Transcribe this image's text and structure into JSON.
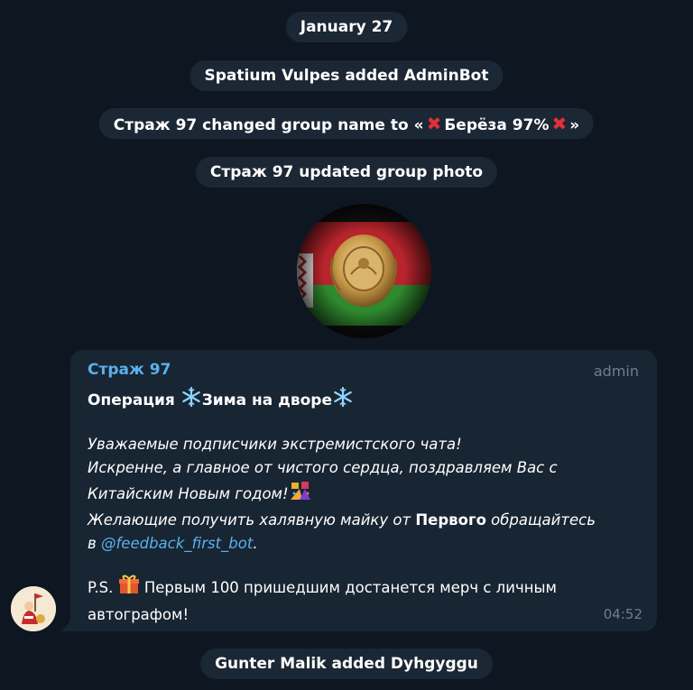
{
  "service_messages": {
    "date": "January 27",
    "added_admin": "Spatium Vulpes added AdminBot",
    "rename_prefix": "Страж 97 changed group name to «",
    "rename_name": "Берёза 97%",
    "rename_suffix": "»",
    "photo_update": "Страж 97 updated group photo",
    "added_user": "Gunter Malik added Dyhgyggu"
  },
  "message": {
    "sender": "Страж 97",
    "role": "admin",
    "title_a": "Операция ",
    "title_b": "Зима на дворе",
    "line1": "Уважаемые подписчики экстремистского чата!",
    "line2": "Искренне, а главное от чистого сердца, поздравляем Вас с",
    "line3": "Китайским Новым годом!",
    "line4a": "Желающие получить халявную майку от ",
    "line4b": "Первого",
    "line4c": " обращайтесь",
    "line5a": "в ",
    "line5_link": "@feedback_first_bot",
    "line5b": ".",
    "ps_a": "P.S. ",
    "ps_b": " Первым 100 пришедшим достанется мерч с личным",
    "ps_c": "автографом!",
    "time": "04:52"
  },
  "icons": {
    "snowflake": "snowflake-icon",
    "cross": "red-cross-icon",
    "celebration": "celebration-icon",
    "gift": "gift-icon"
  },
  "colors": {
    "background": "#0e1621",
    "pill": "#1b2734",
    "bubble": "#182533",
    "accent": "#5ab1ec",
    "muted": "#6d7f8f",
    "cross": "#e0303a"
  }
}
